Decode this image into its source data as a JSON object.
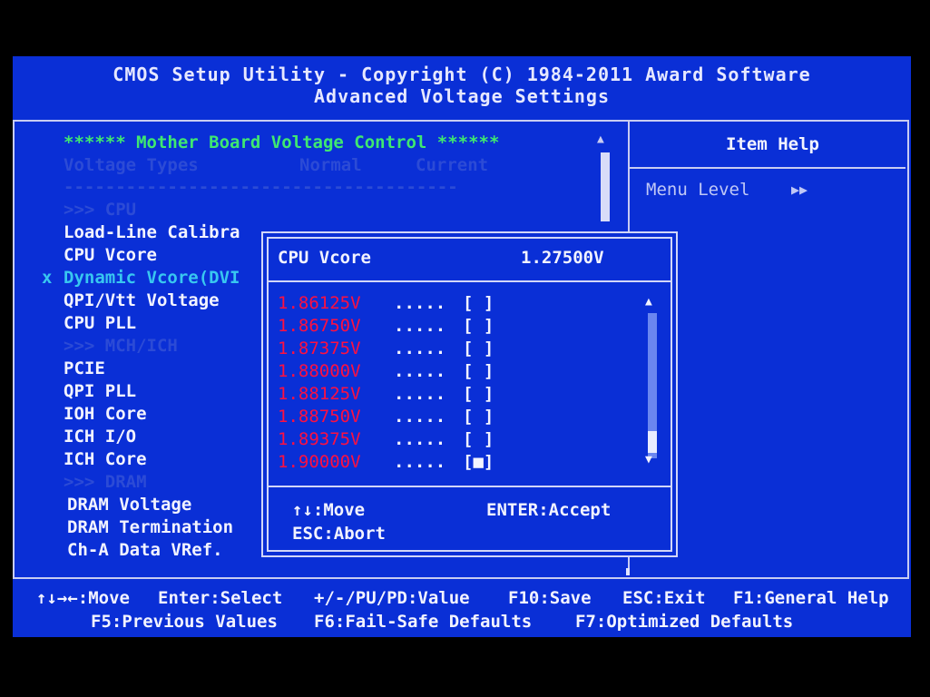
{
  "header": {
    "line1": "CMOS Setup Utility - Copyright (C) 1984-2011 Award Software",
    "line2": "Advanced Voltage Settings"
  },
  "left": {
    "section_title": "****** Mother Board Voltage Control ******",
    "col_types": "Voltage Types",
    "col_normal": "Normal",
    "col_current": "Current",
    "divider": "--------------------------------------",
    "items": [
      {
        "label": ">>> CPU",
        "style": "dim"
      },
      {
        "label": "Load-Line Calibra",
        "style": "white"
      },
      {
        "label": "CPU Vcore",
        "style": "white"
      },
      {
        "label": "Dynamic Vcore(DVI",
        "style": "cyan",
        "marker": "x"
      },
      {
        "label": "QPI/Vtt Voltage",
        "style": "white"
      },
      {
        "label": "CPU PLL",
        "style": "white"
      },
      {
        "label": ">>> MCH/ICH",
        "style": "dim"
      },
      {
        "label": "PCIE",
        "style": "white"
      },
      {
        "label": "QPI PLL",
        "style": "white"
      },
      {
        "label": "IOH Core",
        "style": "white"
      },
      {
        "label": "ICH I/O",
        "style": "white"
      },
      {
        "label": "ICH Core",
        "style": "white"
      },
      {
        "label": ">>> DRAM",
        "style": "dim"
      },
      {
        "label": "DRAM Voltage",
        "style": "white"
      },
      {
        "label": "DRAM Termination",
        "style": "white"
      },
      {
        "label": "Ch-A Data VRef.",
        "style": "white"
      }
    ]
  },
  "help": {
    "title": "Item Help",
    "menu_level": "Menu Level",
    "menu_level_arrows": "▶▶"
  },
  "popup": {
    "title": "CPU Vcore",
    "current_value": "1.27500V",
    "options": [
      {
        "value": "1.86125V",
        "dots": ".....",
        "box": "[ ]"
      },
      {
        "value": "1.86750V",
        "dots": ".....",
        "box": "[ ]"
      },
      {
        "value": "1.87375V",
        "dots": ".....",
        "box": "[ ]"
      },
      {
        "value": "1.88000V",
        "dots": ".....",
        "box": "[ ]"
      },
      {
        "value": "1.88125V",
        "dots": ".....",
        "box": "[ ]"
      },
      {
        "value": "1.88750V",
        "dots": ".....",
        "box": "[ ]"
      },
      {
        "value": "1.89375V",
        "dots": ".....",
        "box": "[ ]"
      },
      {
        "value": "1.90000V",
        "dots": ".....",
        "box": "[■]"
      }
    ],
    "hint_move": "↑↓:Move",
    "hint_accept": "ENTER:Accept",
    "hint_abort": "ESC:Abort",
    "scroll_up": "▲",
    "scroll_down": "▼"
  },
  "footer": {
    "row1": [
      "↑↓→←:Move",
      "Enter:Select",
      "+/-/PU/PD:Value",
      "F10:Save",
      "ESC:Exit",
      "F1:General Help"
    ],
    "row2": [
      "F5:Previous Values",
      "F6:Fail-Safe Defaults",
      "F7:Optimized Defaults"
    ]
  },
  "colors": {
    "background": "#0a2fd6",
    "section_title": "#3fe870",
    "option_value": "#ff1040",
    "highlight": "#38c7f0"
  }
}
